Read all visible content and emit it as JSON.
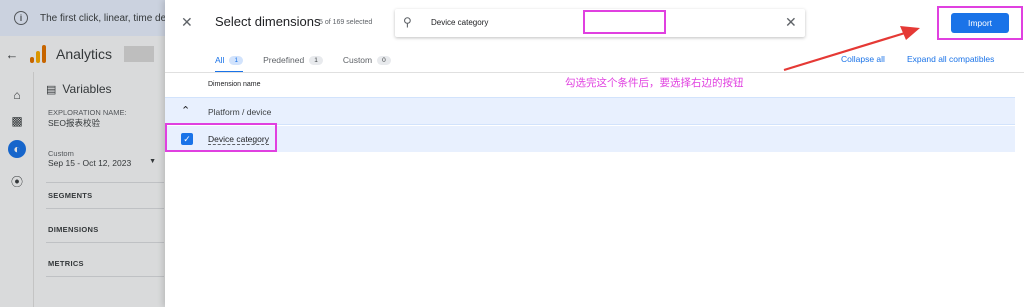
{
  "banner": {
    "text": "The first click, linear, time decay"
  },
  "app": {
    "title": "Analytics"
  },
  "variables_panel": {
    "heading": "Variables",
    "exploration_label": "EXPLORATION NAME:",
    "exploration_value": "SEO报表校验",
    "date_label": "Custom",
    "date_value": "Sep 15 - Oct 12, 2023",
    "segments": "SEGMENTS",
    "dimensions": "DIMENSIONS",
    "metrics": "METRICS"
  },
  "dialog": {
    "title": "Select dimensions",
    "count": "5 of 169 selected",
    "search_value": "Device category",
    "tabs": [
      {
        "label": "All",
        "count": "1"
      },
      {
        "label": "Predefined",
        "count": "1"
      },
      {
        "label": "Custom",
        "count": "0"
      }
    ],
    "collapse_all": "Collapse all",
    "expand_all": "Expand all compatibles",
    "column_header": "Dimension name",
    "group_label": "Platform / device",
    "item_label": "Device category",
    "item_checked": true,
    "import_label": "Import"
  },
  "annotation": {
    "text": "勾选完这个条件后，要选择右边的按钮",
    "color": "#e040e0"
  },
  "colors": {
    "accent": "#1a73e8",
    "highlight": "#e040e0",
    "arrow": "#e53935"
  }
}
